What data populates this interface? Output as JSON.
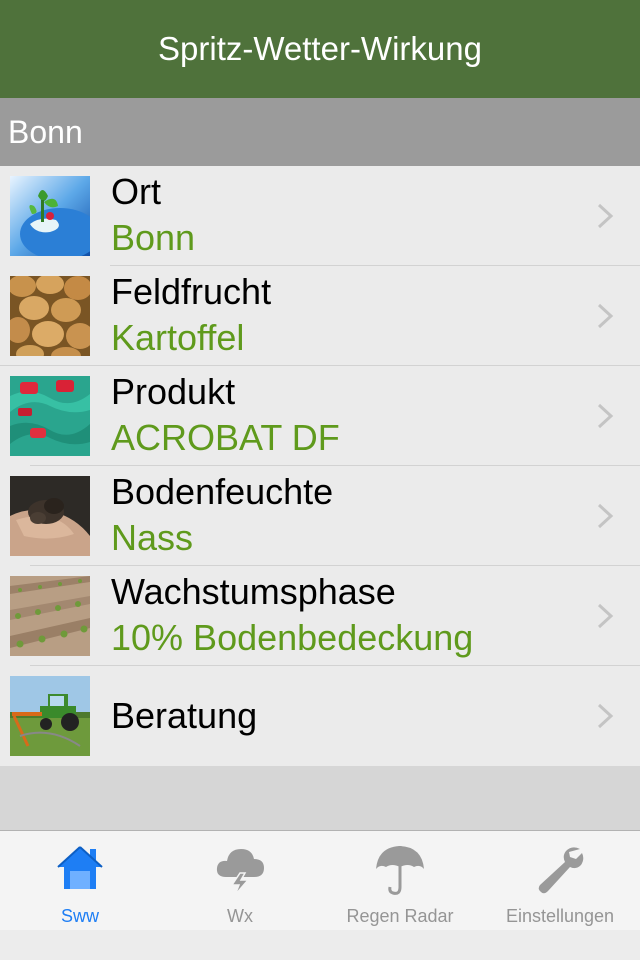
{
  "navbar": {
    "title": "Spritz-Wetter-Wirkung"
  },
  "section": {
    "title": "Bonn"
  },
  "rows": [
    {
      "label": "Ort",
      "value": "Bonn",
      "thumb_icon": "globe-plant-thumbnail"
    },
    {
      "label": "Feldfrucht",
      "value": "Kartoffel",
      "thumb_icon": "potatoes-thumbnail"
    },
    {
      "label": "Produkt",
      "value": "ACROBAT DF",
      "thumb_icon": "product-canisters-thumbnail"
    },
    {
      "label": "Bodenfeuchte",
      "value": "Nass",
      "thumb_icon": "soil-in-hand-thumbnail"
    },
    {
      "label": "Wachstumsphase",
      "value": "10% Bodenbedeckung",
      "thumb_icon": "crop-field-thumbnail"
    },
    {
      "label": "Beratung",
      "value": "",
      "thumb_icon": "tractor-sprayer-thumbnail"
    }
  ],
  "tabs": [
    {
      "label": "Sww",
      "icon": "house-icon",
      "active": true
    },
    {
      "label": "Wx",
      "icon": "storm-cloud-icon",
      "active": false
    },
    {
      "label": "Regen Radar",
      "icon": "umbrella-icon",
      "active": false
    },
    {
      "label": "Einstellungen",
      "icon": "wrench-icon",
      "active": false
    }
  ],
  "colors": {
    "navbar": "#4f723b",
    "value_green": "#5f9a1c",
    "tab_active": "#1e7ef4",
    "tab_inactive": "#959595"
  }
}
